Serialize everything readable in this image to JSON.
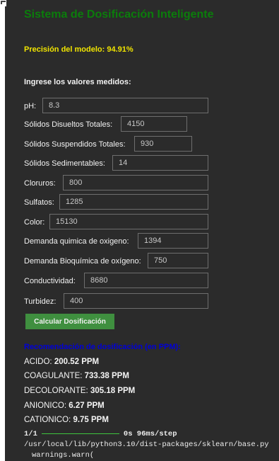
{
  "app": {
    "title": "Sistema de Dosificación Inteligente"
  },
  "precision_text": "Precisión del modelo: 94.91%",
  "prompt_text": "Ingrese los valores medidos:",
  "fields": [
    {
      "label": "pH:",
      "value": "8.3"
    },
    {
      "label": "Sólidos Disueltos Totales:",
      "value": "4150"
    },
    {
      "label": "Sólidos Suspendidos Totales:",
      "value": "930"
    },
    {
      "label": "Sólidos Sedimentables:",
      "value": "14"
    },
    {
      "label": "Cloruros:",
      "value": "800"
    },
    {
      "label": "Sulfatos:",
      "value": "1285"
    },
    {
      "label": "Color:",
      "value": "15130"
    },
    {
      "label": "Demanda quimica de oxigeno:",
      "value": "1394"
    },
    {
      "label": "Demanda Bioquímica de oxígeno:",
      "value": "750"
    },
    {
      "label": "Conductividad:",
      "value": "8680"
    },
    {
      "label": "Turbidez:",
      "value": "400"
    }
  ],
  "button": {
    "label": "Calcular Dosificación"
  },
  "recommendation": {
    "title": "Recomendación de dosificación (en PPM):",
    "items": [
      {
        "name": "ACIDO:",
        "value": "200.52 PPM"
      },
      {
        "name": "COAGULANTE:",
        "value": "733.38 PPM"
      },
      {
        "name": "DECOLORANTE:",
        "value": "305.18 PPM"
      },
      {
        "name": "ANIONICO:",
        "value": "6.27 PPM"
      },
      {
        "name": "CATIONICO:",
        "value": "9.75 PPM"
      }
    ]
  },
  "console": {
    "progress_step": "1/1",
    "progress_time": "0s 96ms/step",
    "warning_path": "/usr/local/lib/python3.10/dist-packages/sklearn/base.py",
    "warning_call": "warnings.warn("
  },
  "colors": {
    "title": "#0b7d0b",
    "precision": "#f0e400",
    "rec_title": "#0000d8",
    "button": "#3f8f3f",
    "progress_bar": "#3ec43e"
  }
}
